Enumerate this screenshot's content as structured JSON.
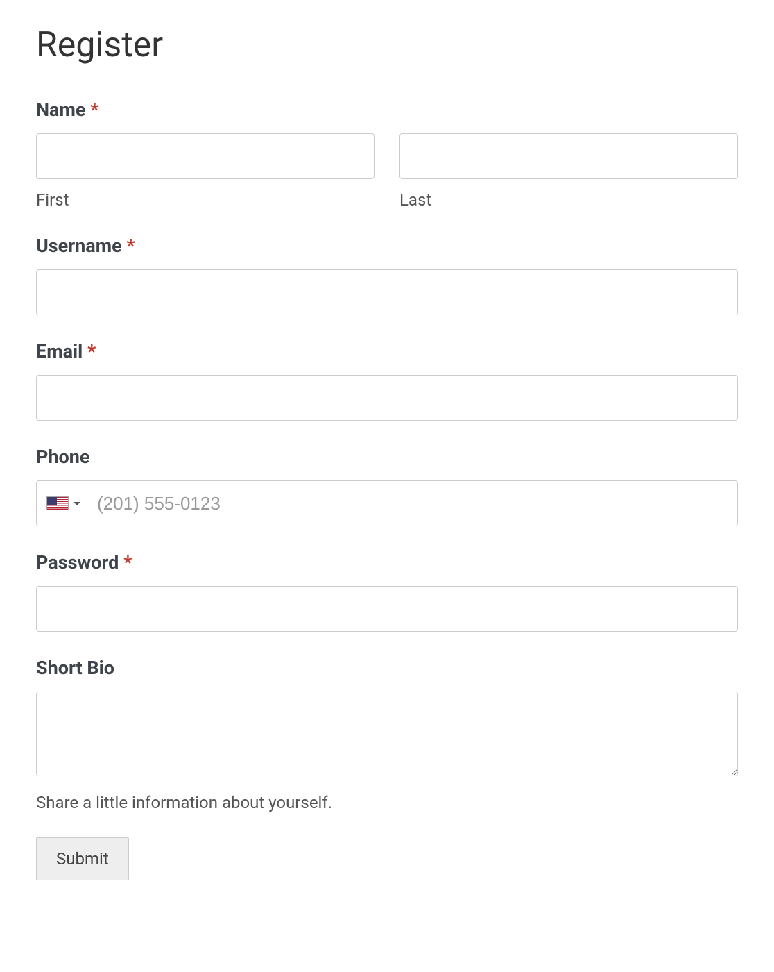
{
  "title": "Register",
  "required_marker": "*",
  "fields": {
    "name": {
      "label": "Name",
      "required": true,
      "first_value": "",
      "first_sublabel": "First",
      "last_value": "",
      "last_sublabel": "Last"
    },
    "username": {
      "label": "Username",
      "required": true,
      "value": ""
    },
    "email": {
      "label": "Email",
      "required": true,
      "value": ""
    },
    "phone": {
      "label": "Phone",
      "required": false,
      "country_flag": "us",
      "placeholder": "(201) 555-0123",
      "value": ""
    },
    "password": {
      "label": "Password",
      "required": true,
      "value": ""
    },
    "bio": {
      "label": "Short Bio",
      "required": false,
      "value": "",
      "help": "Share a little information about yourself."
    }
  },
  "submit_label": "Submit"
}
